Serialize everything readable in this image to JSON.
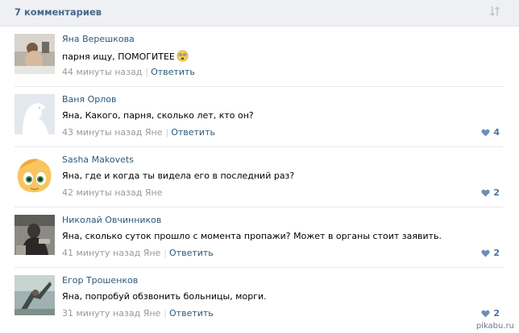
{
  "header": {
    "title": "7 комментариев"
  },
  "comments": [
    {
      "author": "Яна Верешкова",
      "text": "парня ищу, ПОМОГИТЕЕ",
      "time": "44 минуты назад",
      "reply_to": "",
      "reply_label": "Ответить",
      "likes": ""
    },
    {
      "author": "Ваня Орлов",
      "text": "Яна, Какого, парня, сколько лет, кто он?",
      "time": "43 минуты назад",
      "reply_to": "Яне",
      "reply_label": "Ответить",
      "likes": "4"
    },
    {
      "author": "Sasha Makovets",
      "text": "Яна, где и когда ты видела его в последний раз?",
      "time": "42 минуты назад",
      "reply_to": "Яне",
      "reply_label": "",
      "likes": "2"
    },
    {
      "author": "Николай Овчинников",
      "text": "Яна, сколько суток прошло с момента пропажи? Может в органы стоит заявить.",
      "time": "41 минуту назад",
      "reply_to": "Яне",
      "reply_label": "Ответить",
      "likes": "2"
    },
    {
      "author": "Егор Трошенков",
      "text": "Яна, попробуй обзвонить больницы, морги.",
      "time": "31 минуту назад",
      "reply_to": "Яне",
      "reply_label": "Ответить",
      "likes": "2"
    }
  ],
  "watermark": "pikabu.ru"
}
